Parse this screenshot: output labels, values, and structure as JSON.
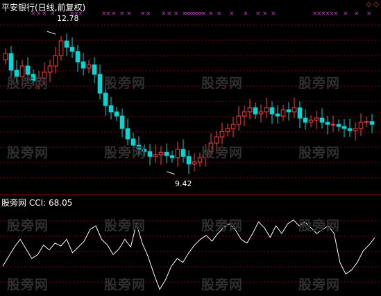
{
  "header": {
    "title": "平安银行(日线,前复权)",
    "title_color": "#ffffff",
    "buttons": [
      "◇",
      "◇"
    ]
  },
  "indicator": {
    "source_label": "股旁网",
    "name": "CCI",
    "value_label": "68.05",
    "label_color": "#ffffff"
  },
  "annotations": {
    "high_label": "12.78",
    "low_label": "9.42"
  },
  "watermark": "股旁网",
  "colors": {
    "background": "#000000",
    "grid": "#8b0000",
    "up": "#ff4040",
    "down": "#00d8d8",
    "marker": "#c040c0",
    "cci": "#ffffff",
    "text": "#ffffff"
  },
  "chart_data": [
    {
      "type": "candlestick",
      "title": "平安银行(日线,前复权)",
      "ylim": [
        9.0,
        13.2
      ],
      "high": 12.78,
      "low": 9.42,
      "close": [
        12.25,
        11.85,
        11.7,
        11.95,
        11.75,
        11.6,
        11.65,
        11.8,
        11.95,
        12.2,
        12.55,
        12.4,
        12.3,
        12.05,
        11.9,
        11.98,
        11.75,
        11.3,
        11.0,
        10.85,
        10.75,
        10.45,
        10.2,
        10.05,
        9.95,
        9.9,
        9.78,
        9.82,
        9.88,
        9.8,
        9.75,
        9.95,
        9.78,
        9.6,
        9.65,
        9.75,
        9.9,
        10.1,
        10.25,
        10.38,
        10.45,
        10.55,
        10.75,
        10.85,
        10.95,
        10.8,
        10.85,
        10.95,
        10.8,
        10.75,
        10.9,
        10.85,
        10.95,
        10.7,
        10.6,
        10.65,
        10.7,
        10.6,
        10.55,
        10.55,
        10.5,
        10.45,
        10.4,
        10.45,
        10.6,
        10.62,
        10.55
      ],
      "volume_markers": true
    },
    {
      "type": "line",
      "title": "CCI",
      "series": [
        {
          "name": "CCI",
          "values": [
            -80,
            -30,
            20,
            60,
            10,
            -40,
            -20,
            30,
            5,
            40,
            25,
            60,
            -10,
            20,
            50,
            110,
            130,
            60,
            30,
            -20,
            10,
            60,
            20,
            140,
            40,
            -30,
            -120,
            -200,
            -150,
            -80,
            -40,
            -60,
            -10,
            30,
            60,
            80,
            50,
            90,
            120,
            140,
            110,
            60,
            40,
            90,
            150,
            120,
            70,
            130,
            90,
            140,
            160,
            130,
            150,
            120,
            90,
            110,
            130,
            90,
            -60,
            -120,
            -100,
            -60,
            0,
            30,
            68
          ]
        }
      ],
      "last_value": 68.05
    }
  ]
}
